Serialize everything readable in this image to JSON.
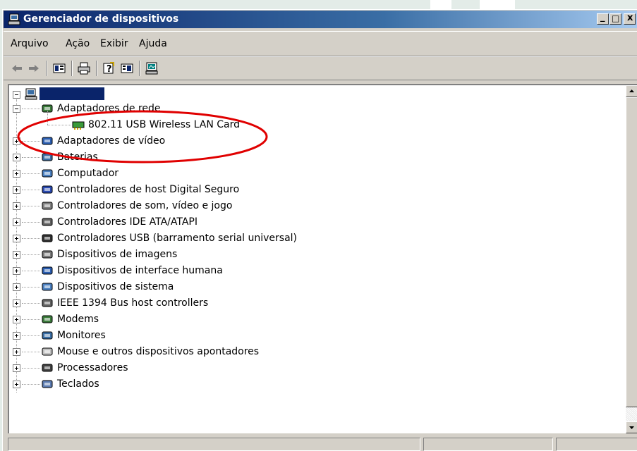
{
  "window": {
    "title": "Gerenciador de dispositivos",
    "minimize_glyph": "_",
    "maximize_glyph": "□",
    "close_glyph": "x"
  },
  "menu": [
    "Arquivo",
    "Ação",
    "Exibir",
    "Ajuda"
  ],
  "toolbar": {
    "icons": [
      "back-arrow-icon",
      "forward-arrow-icon",
      "properties-icon",
      "print-icon",
      "help-icon",
      "view-icon",
      "scan-hardware-icon"
    ]
  },
  "tree": {
    "root_label": "",
    "categories": [
      {
        "label": "Adaptadores de rede",
        "expanded": true,
        "icon": "network-adapter-icon",
        "children": [
          {
            "label": "802.11 USB Wireless LAN Card",
            "icon": "network-card-icon"
          }
        ]
      },
      {
        "label": "Adaptadores de vídeo",
        "icon": "display-adapter-icon"
      },
      {
        "label": "Baterias",
        "icon": "battery-icon"
      },
      {
        "label": "Computador",
        "icon": "computer-icon"
      },
      {
        "label": "Controladores de host Digital Seguro",
        "icon": "sd-host-icon"
      },
      {
        "label": "Controladores de som, vídeo e jogo",
        "icon": "sound-icon"
      },
      {
        "label": "Controladores IDE ATA/ATAPI",
        "icon": "ide-controller-icon"
      },
      {
        "label": "Controladores USB (barramento serial universal)",
        "icon": "usb-icon"
      },
      {
        "label": "Dispositivos de imagens",
        "icon": "imaging-device-icon"
      },
      {
        "label": "Dispositivos de interface humana",
        "icon": "hid-icon"
      },
      {
        "label": "Dispositivos de sistema",
        "icon": "system-device-icon"
      },
      {
        "label": "IEEE 1394 Bus host controllers",
        "icon": "firewire-icon"
      },
      {
        "label": "Modems",
        "icon": "modem-icon"
      },
      {
        "label": "Monitores",
        "icon": "monitor-icon"
      },
      {
        "label": "Mouse e outros dispositivos apontadores",
        "icon": "mouse-icon"
      },
      {
        "label": "Processadores",
        "icon": "processor-icon"
      },
      {
        "label": "Teclados",
        "icon": "keyboard-icon"
      }
    ]
  },
  "annotation": {
    "type": "red ellipse",
    "color": "#e00000"
  },
  "colors": {
    "title_bar": "#0a246a",
    "selection": "#0a246a",
    "window_face": "#d4d0c8"
  }
}
